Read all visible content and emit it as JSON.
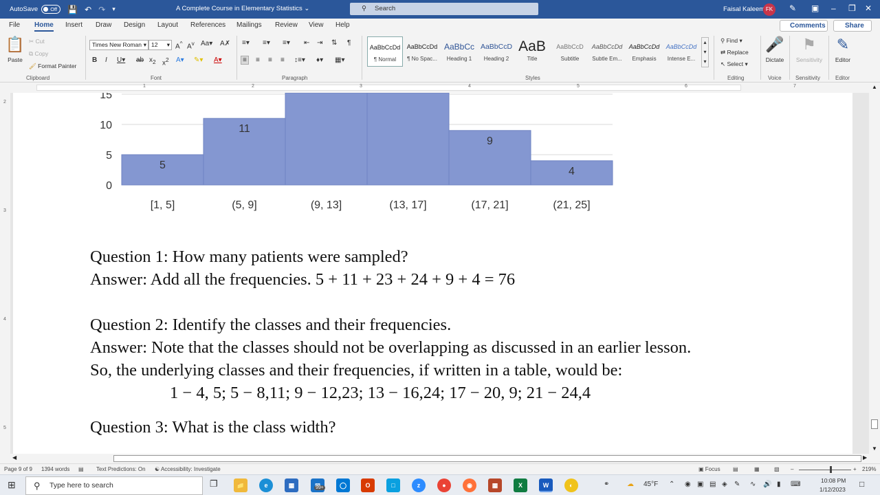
{
  "titlebar": {
    "autosave_label": "AutoSave",
    "autosave_state": "Off",
    "document_title": "A Complete Course in Elementary Statistics",
    "search_placeholder": "Search",
    "user_name": "Faisal Kaleem",
    "user_initials": "FK"
  },
  "tabs": [
    "File",
    "Home",
    "Insert",
    "Draw",
    "Design",
    "Layout",
    "References",
    "Mailings",
    "Review",
    "View",
    "Help"
  ],
  "active_tab": "Home",
  "actions": {
    "comments": "Comments",
    "share": "Share"
  },
  "ribbon": {
    "clipboard": {
      "paste": "Paste",
      "cut": "Cut",
      "copy": "Copy",
      "format_painter": "Format Painter",
      "label": "Clipboard"
    },
    "font": {
      "name": "Times New Roman",
      "size": "12",
      "label": "Font"
    },
    "paragraph": {
      "label": "Paragraph"
    },
    "styles": {
      "label": "Styles",
      "items": [
        {
          "preview": "AaBbCcDd",
          "label": "¶ Normal"
        },
        {
          "preview": "AaBbCcDd",
          "label": "¶ No Spac..."
        },
        {
          "preview": "AaBbCc",
          "label": "Heading 1"
        },
        {
          "preview": "AaBbCcD",
          "label": "Heading 2"
        },
        {
          "preview": "AaB",
          "label": "Title"
        },
        {
          "preview": "AaBbCcD",
          "label": "Subtitle"
        },
        {
          "preview": "AaBbCcDd",
          "label": "Subtle Em..."
        },
        {
          "preview": "AaBbCcDd",
          "label": "Emphasis"
        },
        {
          "preview": "AaBbCcDd",
          "label": "Intense E..."
        }
      ]
    },
    "editing": {
      "find": "Find",
      "replace": "Replace",
      "select": "Select",
      "label": "Editing"
    },
    "voice": {
      "dictate": "Dictate",
      "label": "Voice"
    },
    "sensitivity": {
      "button": "Sensitivity",
      "label": "Sensitivity"
    },
    "editor": {
      "button": "Editor",
      "label": "Editor"
    }
  },
  "ruler": {
    "h_numbers": [
      "1",
      "2",
      "3",
      "4",
      "5",
      "6",
      "7"
    ],
    "v_numbers": [
      "2",
      "3",
      "4",
      "5"
    ]
  },
  "chart_data": {
    "type": "bar",
    "categories": [
      "[1, 5]",
      "(5, 9]",
      "(9, 13]",
      "(13, 17]",
      "(17, 21]",
      "(21, 25]"
    ],
    "values": [
      5,
      11,
      23,
      24,
      9,
      4
    ],
    "data_labels": [
      "5",
      "11",
      "",
      "",
      "9",
      "4"
    ],
    "y_ticks": [
      "0",
      "5",
      "10",
      "15"
    ],
    "ylim": [
      0,
      15
    ],
    "grid": true,
    "color": "#8497d1",
    "edge_color": "#6e83c2"
  },
  "document": {
    "lines": [
      "Question 1: How many patients were sampled?",
      "Answer: Add all the frequencies. 5 + 11 + 23 + 24 + 9 + 4 = 76",
      "Question 2: Identify the classes and their frequencies.",
      "Answer:  Note that the classes should not be overlapping as discussed in an earlier lesson.",
      "So, the underlying classes and their frequencies, if written in a table, would be:",
      "1 − 4, 5;  5 − 8,11; 9 − 12,23; 13 − 16,24;  17 − 20, 9; 21 − 24,4",
      "Question 3: What is the class width?"
    ]
  },
  "statusbar": {
    "page": "Page 9 of 9",
    "words": "1394 words",
    "text_predictions": "Text Predictions: On",
    "accessibility": "Accessibility: Investigate",
    "focus": "Focus",
    "zoom": "219%"
  },
  "taskbar": {
    "search_placeholder": "Type here to search",
    "badge": "99+",
    "weather": "45°F",
    "time": "10:08 PM",
    "date": "1/12/2023"
  }
}
